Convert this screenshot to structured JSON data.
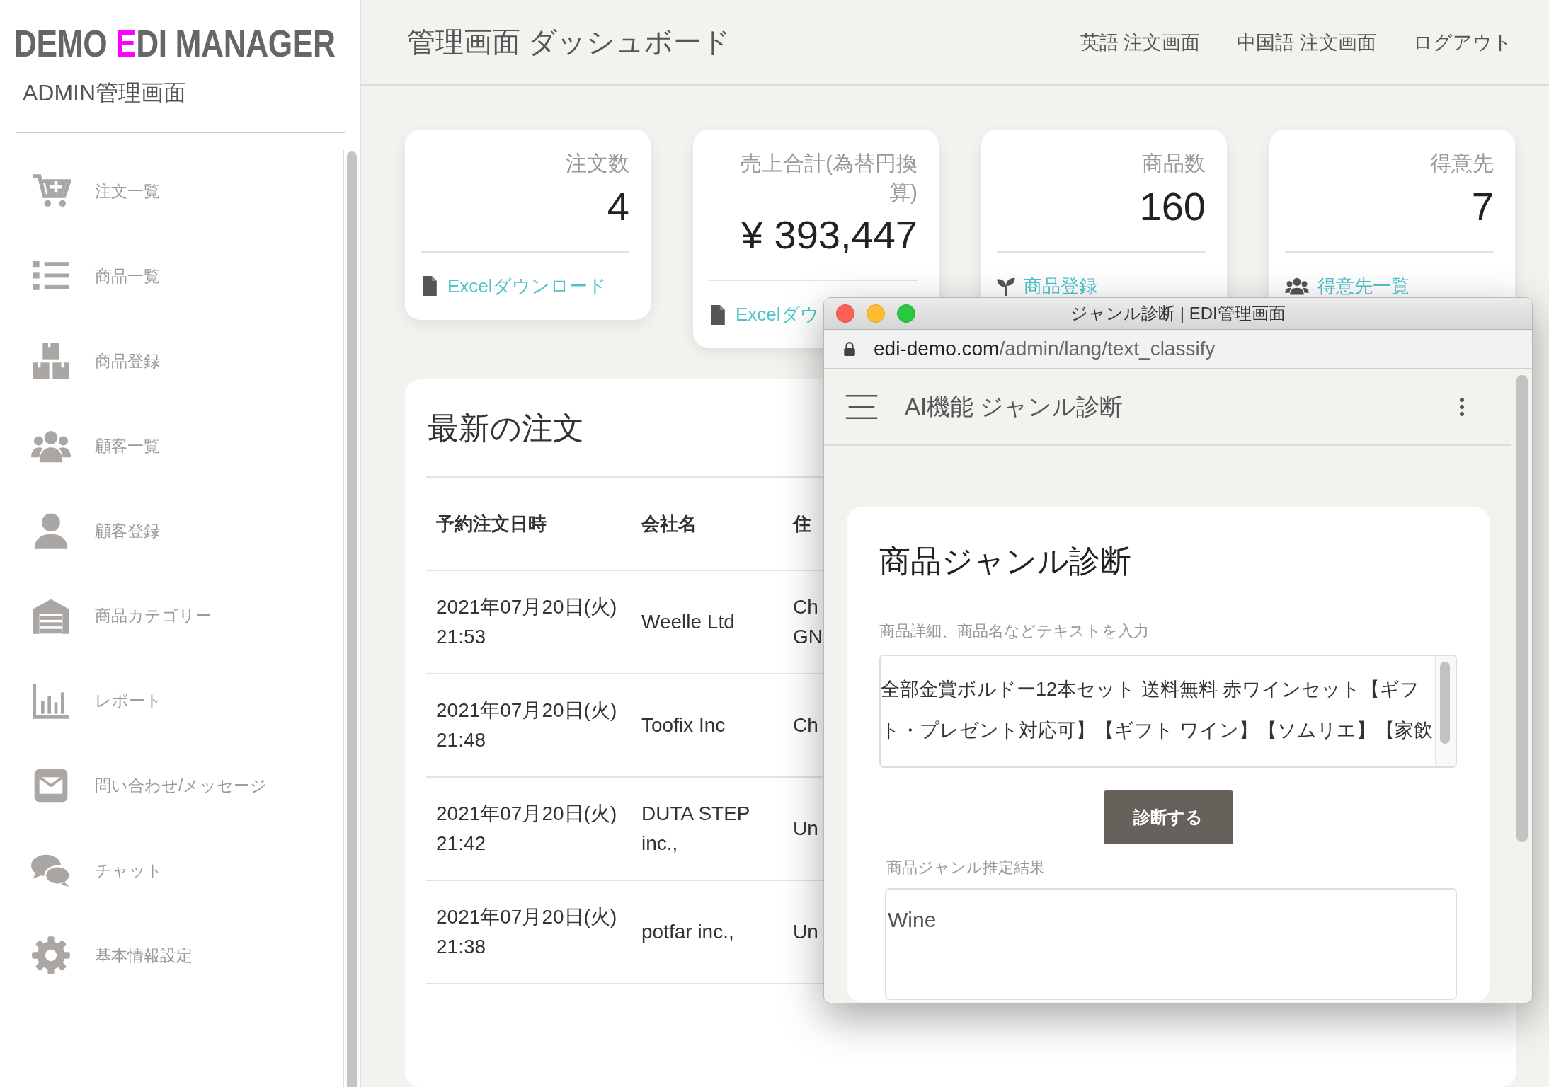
{
  "sidebar": {
    "logo": [
      {
        "text": "DEMO ",
        "highlight": false
      },
      {
        "text": "E",
        "highlight": true
      },
      {
        "text": "DI MANAGER",
        "highlight": false
      }
    ],
    "subtitle": "ADMIN管理画面",
    "items": [
      {
        "label": "注文一覧"
      },
      {
        "label": "商品一覧"
      },
      {
        "label": "商品登録"
      },
      {
        "label": "顧客一覧"
      },
      {
        "label": "顧客登録"
      },
      {
        "label": "商品カテゴリー"
      },
      {
        "label": "レポート"
      },
      {
        "label": "問い合わせ/メッセージ"
      },
      {
        "label": "チャット"
      },
      {
        "label": "基本情報設定"
      }
    ]
  },
  "header": {
    "title": "管理画面 ダッシュボード",
    "links": [
      "英語 注文画面",
      "中国語 注文画面",
      "ログアウト"
    ]
  },
  "stats": [
    {
      "title": "注文数",
      "value": "4",
      "link": "Excelダウンロード"
    },
    {
      "title": "売上合計(為替円換算)",
      "value": "¥ 393,447",
      "link": "Excelダウ"
    },
    {
      "title": "商品数",
      "value": "160",
      "link": "商品登録"
    },
    {
      "title": "得意先",
      "value": "7",
      "link": "得意先一覧"
    }
  ],
  "orders": {
    "title": "最新の注文",
    "columns": [
      "予約注文日時",
      "会社名",
      "住"
    ],
    "rows": [
      {
        "date": "2021年07月20日(火) 21:53",
        "company": "Weelle Ltd",
        "column_3": "Ch\nGN"
      },
      {
        "date": "2021年07月20日(火) 21:48",
        "company": "Toofix Inc",
        "column_3": "Ch"
      },
      {
        "date": "2021年07月20日(火) 21:42",
        "company": "DUTA STEP inc.,",
        "column_3": "Un"
      },
      {
        "date": "2021年07月20日(火) 21:38",
        "company": "potfar inc.,",
        "column_3": "Un"
      }
    ]
  },
  "popup": {
    "title": "ジャンル診断 | EDI管理画面",
    "url_host": "edi-demo.com",
    "url_path": "/admin/lang/text_classify",
    "app_title": "AI機能 ジャンル診断",
    "card_title": "商品ジャンル診断",
    "input_label": "商品詳細、商品名などテキストを入力",
    "input_value": "全部金賞ボルドー12本セット 送料無料 赤ワインセット【ギフト・プレゼント対応可】【ギフト ワイン】【ソムリエ】【家飲",
    "button": "診断する",
    "result_label": "商品ジャンル推定結果",
    "result_value": "Wine"
  }
}
